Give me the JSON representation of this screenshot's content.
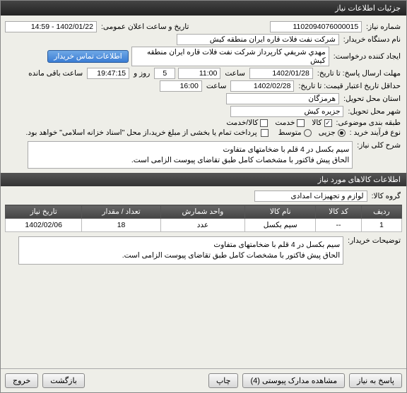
{
  "window": {
    "title": "جزئیات اطلاعات نیاز"
  },
  "fields": {
    "reqNumLabel": "شماره نیاز:",
    "reqNum": "1102094076000015",
    "announceLabel": "تاریخ و ساعت اعلان عمومی:",
    "announce": "1402/01/22 - 14:59",
    "buyerOrgLabel": "نام دستگاه خریدار:",
    "buyerOrg": "شرکت نفت فلات قاره ایران منطقه کیش",
    "requesterLabel": "ایجاد کننده درخواست:",
    "requester": "مهدي شريفي کارپرداز شرکت نفت فلات قاره ایران منطقه کیش",
    "contactBtn": "اطلاعات تماس خریدار",
    "deadlineLabel": "مهلت ارسال پاسخ: تا تاریخ:",
    "deadlineDate": "1402/01/28",
    "timeLabel": "ساعت",
    "deadlineTime": "11:00",
    "daysLabel": "روز و",
    "daysVal": "5",
    "remainTime": "19:47:15",
    "remainLabel": "ساعت باقی مانده",
    "validityLabel": "حداقل تاریخ اعتبار قیمت: تا تاریخ:",
    "validityDate": "1402/02/28",
    "validityTime": "16:00",
    "provinceLabel": "استان محل تحویل:",
    "province": "هرمزگان",
    "cityLabel": "شهر محل تحویل:",
    "city": "جزیره کیش",
    "categoryLabel": "طبقه بندی موضوعی:",
    "catGoods": "کالا",
    "catService": "خدمت",
    "catGoodsService": "کالا/خدمت",
    "processLabel": "نوع فرآیند خرید :",
    "procPartial": "جزیی",
    "procMedium": "متوسط",
    "processNote": "پرداخت تمام یا بخشی از مبلغ خرید،از محل \"اسناد خزانه اسلامی\" خواهد بود.",
    "descLabel": "شرح کلی نیاز:",
    "descLine1": "سیم بکسل در 4 قلم با ضخامتهای متفاوت",
    "descLine2": "الحاق پیش فاکتور با مشخصات کامل طبق تقاضای پیوست الزامی است.",
    "itemsSection": "اطلاعات کالاهای مورد نیاز",
    "groupLabel": "گروه کالا:",
    "group": "لوازم و تجهیزات امدادی",
    "buyerNotesLabel": "توضیحات خریدار:",
    "noteLine1": "سیم بکسل در 4 قلم با ضخامتهای متفاوت",
    "noteLine2": "الحاق پیش فاکتور با مشخصات کامل طبق تقاضای پیوست الزامی است."
  },
  "tableHeaders": {
    "row": "ردیف",
    "code": "کد کالا",
    "name": "نام کالا",
    "unit": "واحد شمارش",
    "qty": "تعداد / مقدار",
    "date": "تاریخ نیاز"
  },
  "tableRows": [
    {
      "row": "1",
      "code": "--",
      "name": "سیم بکسل",
      "unit": "عدد",
      "qty": "18",
      "date": "1402/02/06"
    }
  ],
  "footer": {
    "respond": "پاسخ به نیاز",
    "attachments": "مشاهده مدارک پیوستی (4)",
    "print": "چاپ",
    "back": "بازگشت",
    "exit": "خروج"
  }
}
